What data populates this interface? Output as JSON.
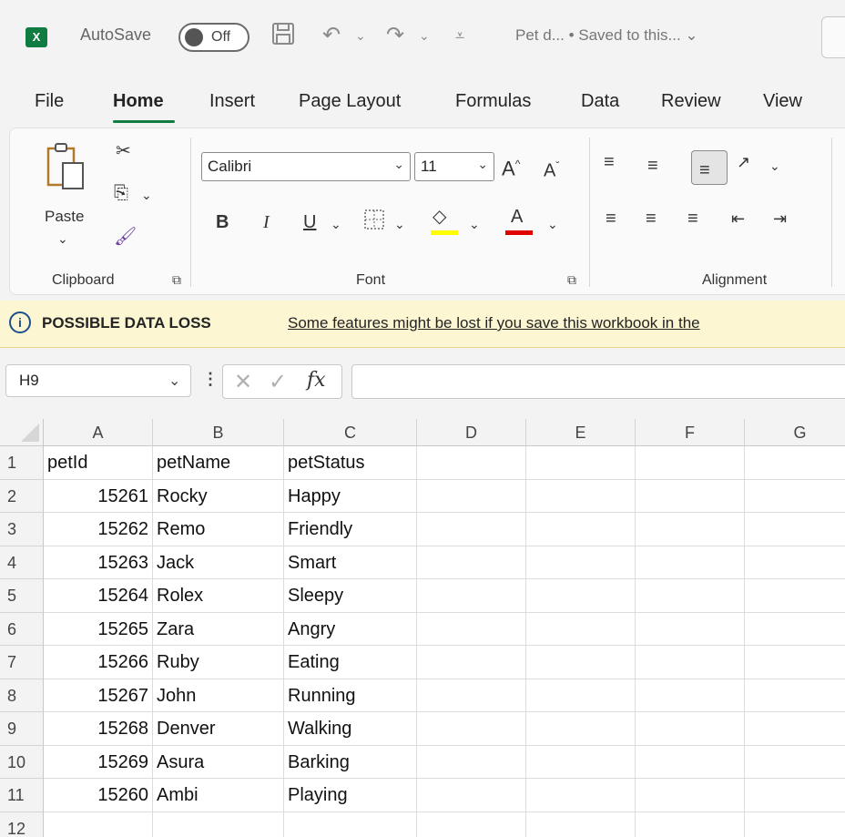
{
  "titlebar": {
    "autosave_label": "AutoSave",
    "autosave_state": "Off",
    "document_title": "Pet d... • Saved to this... ⌄",
    "app_icon": "X"
  },
  "menu": {
    "tabs": [
      "File",
      "Home",
      "Insert",
      "Page Layout",
      "Formulas",
      "Data",
      "Review",
      "View"
    ],
    "active": "Home"
  },
  "ribbon": {
    "clipboard": {
      "paste_label": "Paste",
      "group_label": "Clipboard"
    },
    "font": {
      "font_name": "Calibri",
      "font_size": "11",
      "bold": "B",
      "italic": "I",
      "underline": "U",
      "group_label": "Font",
      "highlight_color": "#ffff00",
      "font_color": "#e00000"
    },
    "alignment": {
      "group_label": "Alignment"
    }
  },
  "infobar": {
    "title": "POSSIBLE DATA LOSS",
    "message": "Some features might be lost if you save this workbook in the"
  },
  "formula_bar": {
    "name_box": "H9",
    "fx": "fx",
    "value": ""
  },
  "sheet": {
    "columns": [
      "A",
      "B",
      "C",
      "D",
      "E",
      "F",
      "G"
    ],
    "row_numbers": [
      "1",
      "2",
      "3",
      "4",
      "5",
      "6",
      "7",
      "8",
      "9",
      "10",
      "11",
      "12"
    ],
    "header_row": [
      "petId",
      "petName",
      "petStatus"
    ],
    "rows": [
      [
        "15261",
        "Rocky",
        "Happy"
      ],
      [
        "15262",
        "Remo",
        "Friendly"
      ],
      [
        "15263",
        "Jack",
        "Smart"
      ],
      [
        "15264",
        "Rolex",
        "Sleepy"
      ],
      [
        "15265",
        "Zara",
        "Angry"
      ],
      [
        "15266",
        "Ruby",
        "Eating"
      ],
      [
        "15267",
        "John",
        "Running"
      ],
      [
        "15268",
        "Denver",
        "Walking"
      ],
      [
        "15269",
        "Asura",
        "Barking"
      ],
      [
        "15260",
        "Ambi",
        "Playing"
      ]
    ]
  }
}
